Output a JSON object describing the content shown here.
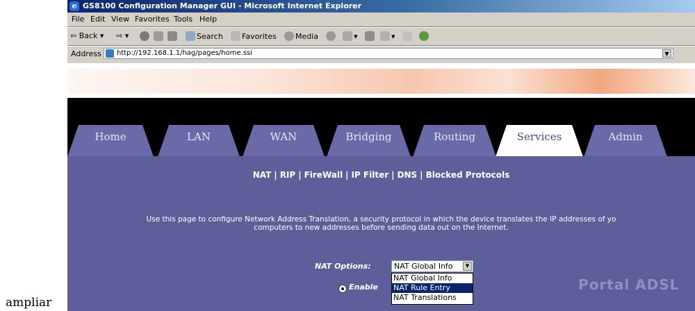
{
  "caption": "ampliar",
  "window": {
    "title": "GS8100 Configuration Manager GUI - Microsoft Internet Explorer"
  },
  "menu": [
    "File",
    "Edit",
    "View",
    "Favorites",
    "Tools",
    "Help"
  ],
  "toolbar": {
    "back": "Back",
    "search": "Search",
    "favorites": "Favorites",
    "media": "Media"
  },
  "address": {
    "label": "Address",
    "url": "http://192.168.1.1/hag/pages/home.ssi"
  },
  "tabs": [
    "Home",
    "LAN",
    "WAN",
    "Bridging",
    "Routing",
    "Services",
    "Admin"
  ],
  "active_tab": "Services",
  "subnav": [
    "NAT",
    "RIP",
    "FireWall",
    "IP Filter",
    "DNS",
    "Blocked Protocols"
  ],
  "description": {
    "line1": "Use this page to configure Network Address Translation, a security protocol in which the device translates the IP addresses of yo",
    "line2": "computers to new addresses before sending data out on the Internet."
  },
  "nat_options": {
    "label": "NAT Options:",
    "selected": "NAT Global Info",
    "options": [
      "NAT Global Info",
      "NAT Rule Entry",
      "NAT Translations"
    ],
    "highlighted": "NAT Rule Entry"
  },
  "enable_label": "Enable",
  "watermark": "Portal ADSL",
  "colors": {
    "panel": "#5e5e9a",
    "tab": "#6a6aa8",
    "titlebar": "#0a246a"
  }
}
